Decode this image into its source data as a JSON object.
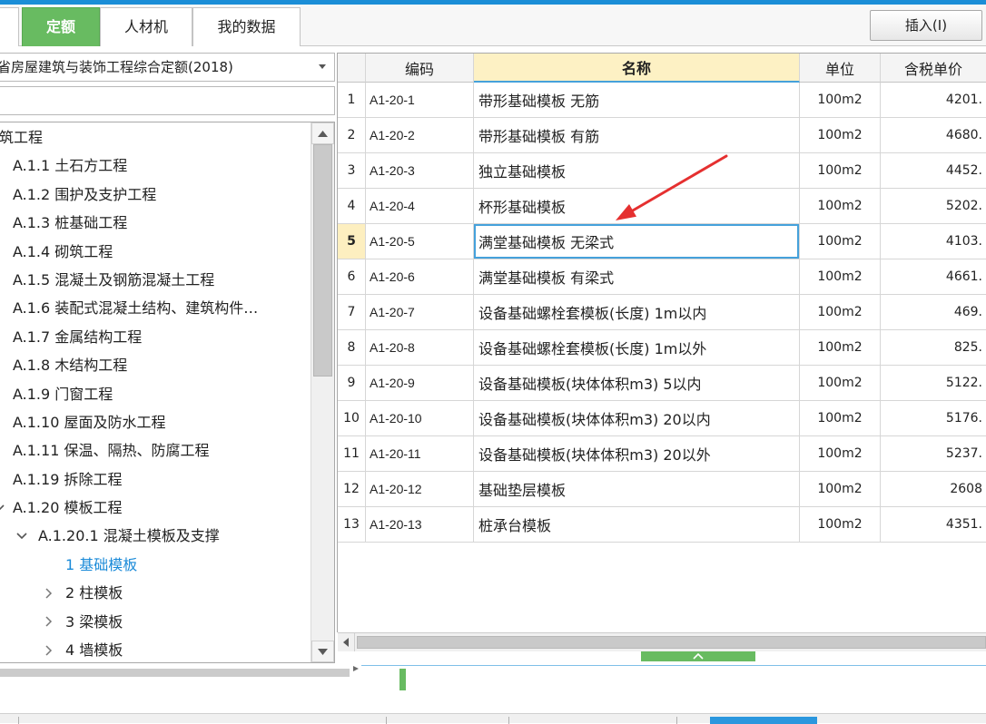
{
  "app": {
    "tabs": [
      {
        "label": "定额",
        "active": true
      },
      {
        "label": "人材机",
        "active": false
      },
      {
        "label": "我的数据",
        "active": false
      }
    ],
    "insert_button": "插入(I)"
  },
  "library": {
    "selected": "省房屋建筑与装饰工程综合定额(2018)"
  },
  "tree": {
    "items": [
      {
        "label": "筑工程"
      },
      {
        "label": "A.1.1 土石方工程"
      },
      {
        "label": "A.1.2 围护及支护工程"
      },
      {
        "label": "A.1.3 桩基础工程"
      },
      {
        "label": "A.1.4 砌筑工程"
      },
      {
        "label": "A.1.5 混凝土及钢筋混凝土工程"
      },
      {
        "label": "A.1.6 装配式混凝土结构、建筑构件…"
      },
      {
        "label": "A.1.7 金属结构工程"
      },
      {
        "label": "A.1.8 木结构工程"
      },
      {
        "label": "A.1.9 门窗工程"
      },
      {
        "label": "A.1.10 屋面及防水工程"
      },
      {
        "label": "A.1.11 保温、隔热、防腐工程"
      },
      {
        "label": "A.1.19 拆除工程"
      },
      {
        "label": "A.1.20 模板工程",
        "expanded": true
      },
      {
        "label": "A.1.20.1 混凝土模板及支撑",
        "expanded": true
      },
      {
        "label": "1 基础模板",
        "selected": true
      },
      {
        "label": "2 柱模板",
        "expanded": false
      },
      {
        "label": "3 梁模板",
        "expanded": false
      },
      {
        "label": "4 墙模板",
        "expanded": false
      }
    ]
  },
  "table": {
    "columns": {
      "code": "编码",
      "name": "名称",
      "unit": "单位",
      "price": "含税单价"
    },
    "rows": [
      {
        "no": "1",
        "code": "A1-20-1",
        "name": "带形基础模板 无筋",
        "unit": "100m2",
        "price": "4201."
      },
      {
        "no": "2",
        "code": "A1-20-2",
        "name": "带形基础模板 有筋",
        "unit": "100m2",
        "price": "4680."
      },
      {
        "no": "3",
        "code": "A1-20-3",
        "name": "独立基础模板",
        "unit": "100m2",
        "price": "4452."
      },
      {
        "no": "4",
        "code": "A1-20-4",
        "name": "杯形基础模板",
        "unit": "100m2",
        "price": "5202."
      },
      {
        "no": "5",
        "code": "A1-20-5",
        "name": "满堂基础模板 无梁式",
        "unit": "100m2",
        "price": "4103.",
        "selected": true
      },
      {
        "no": "6",
        "code": "A1-20-6",
        "name": "满堂基础模板 有梁式",
        "unit": "100m2",
        "price": "4661."
      },
      {
        "no": "7",
        "code": "A1-20-7",
        "name": "设备基础螺栓套模板(长度) 1m以内",
        "unit": "100m2",
        "price": "469."
      },
      {
        "no": "8",
        "code": "A1-20-8",
        "name": "设备基础螺栓套模板(长度) 1m以外",
        "unit": "100m2",
        "price": "825."
      },
      {
        "no": "9",
        "code": "A1-20-9",
        "name": "设备基础模板(块体体积m3) 5以内",
        "unit": "100m2",
        "price": "5122."
      },
      {
        "no": "10",
        "code": "A1-20-10",
        "name": "设备基础模板(块体体积m3) 20以内",
        "unit": "100m2",
        "price": "5176."
      },
      {
        "no": "11",
        "code": "A1-20-11",
        "name": "设备基础模板(块体体积m3) 20以外",
        "unit": "100m2",
        "price": "5237."
      },
      {
        "no": "12",
        "code": "A1-20-12",
        "name": "基础垫层模板",
        "unit": "100m2",
        "price": "2608"
      },
      {
        "no": "13",
        "code": "A1-20-13",
        "name": "桩承台模板",
        "unit": "100m2",
        "price": "4351."
      }
    ]
  },
  "theme": {
    "accent_green": "#68bb61",
    "top_blue": "#1b8ed7",
    "selection_blue": "#45a1db",
    "tree_selected_text": "#1a8ad8",
    "header_highlight": "#fdf1c4",
    "annotation_red": "#e53030"
  },
  "icons": {
    "library_dropdown": "caret-down-icon",
    "scroll_up": "caret-up-icon",
    "scroll_down": "caret-down-icon",
    "scroll_left": "caret-left-icon",
    "tree_expanded": "chevron-down-icon",
    "tree_collapsed": "chevron-right-icon",
    "panel_collapse": "chevron-up-icon",
    "annotation": "red-arrow"
  }
}
